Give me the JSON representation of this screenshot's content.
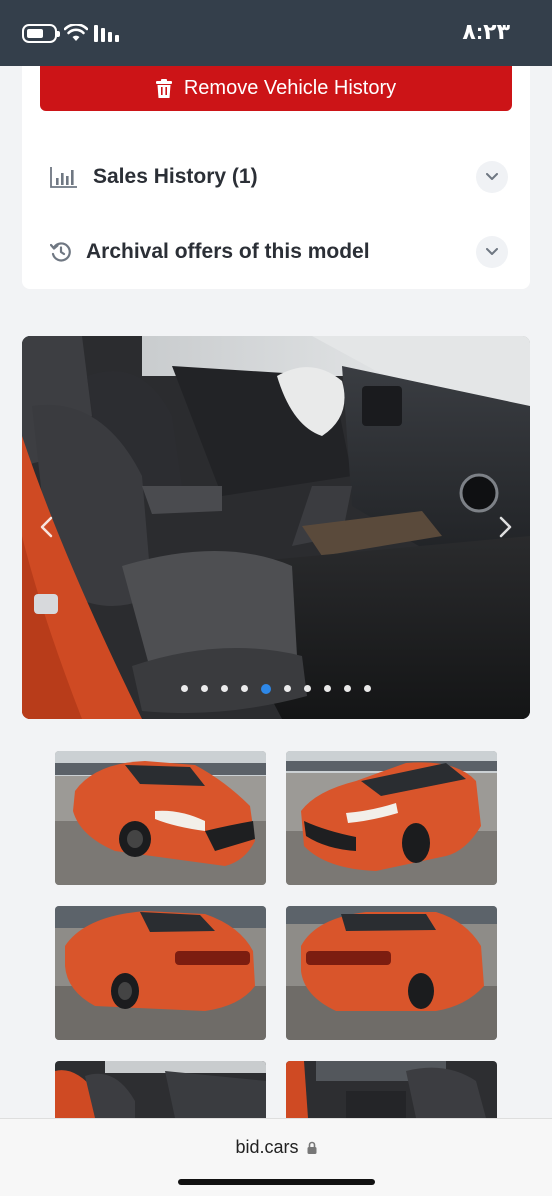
{
  "status_bar": {
    "time": "٨:٢٣",
    "icons": [
      "battery-icon",
      "wifi-icon",
      "signal-icon"
    ]
  },
  "vehicle_panel": {
    "remove_history_label": "Remove Vehicle History",
    "sections": [
      {
        "label": "Sales History (1)",
        "icon": "bar-chart-icon"
      },
      {
        "label": "Archival offers of this model",
        "icon": "history-icon"
      }
    ]
  },
  "gallery": {
    "slide_count": 10,
    "active_index": 4,
    "main_photo": "car interior, front seats and dashboard",
    "thumbnails": [
      "front-left exterior",
      "front-right exterior",
      "rear-left exterior",
      "rear-right exterior",
      "interior driver side",
      "interior passenger side"
    ]
  },
  "browser": {
    "url": "bid.cars",
    "secure_icon": "lock-icon"
  },
  "colors": {
    "status_bar": "#343f4b",
    "remove_button": "#cc1417",
    "active_dot": "#2e88e8",
    "car_body": "#d9552b"
  }
}
